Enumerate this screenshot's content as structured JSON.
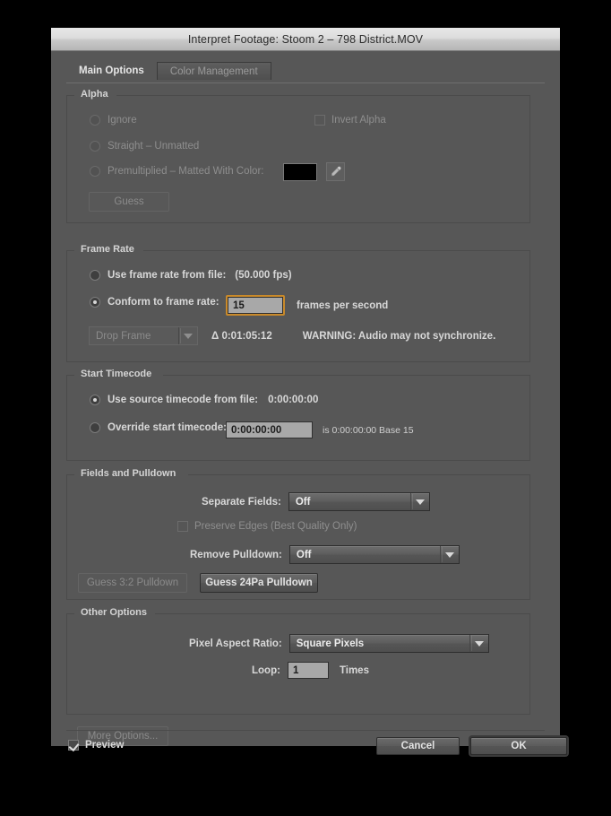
{
  "window": {
    "title": "Interpret Footage: Stoom 2 – 798 District.MOV"
  },
  "tabs": [
    {
      "label": "Main Options",
      "active": true
    },
    {
      "label": "Color Management",
      "active": false
    }
  ],
  "alpha": {
    "legend": "Alpha",
    "ignore_label": "Ignore",
    "straight_label": "Straight – Unmatted",
    "premultiplied_label": "Premultiplied – Matted With Color:",
    "invert_alpha_label": "Invert Alpha",
    "guess_label": "Guess",
    "matte_color": "#000000",
    "eyedropper_icon": "eyedropper-icon",
    "enabled": false
  },
  "frame_rate": {
    "legend": "Frame Rate",
    "use_from_file_label": "Use frame rate from file:",
    "file_fps": "(50.000 fps)",
    "conform_label": "Conform to frame rate:",
    "conform_value": "15",
    "fps_suffix": "frames per second",
    "drop_frame_value": "Drop Frame",
    "delta_label": "Δ 0:01:05:12",
    "warning": "WARNING: Audio may not synchronize."
  },
  "start_timecode": {
    "legend": "Start Timecode",
    "use_source_label": "Use source timecode from file:",
    "source_value": "0:00:00:00",
    "override_label": "Override start timecode:",
    "override_value": "0:00:00:00",
    "override_note": "is 0:00:00:00  Base 15"
  },
  "fields_pulldown": {
    "legend": "Fields and Pulldown",
    "separate_fields_label": "Separate Fields:",
    "separate_fields_value": "Off",
    "preserve_edges_label": "Preserve Edges (Best Quality Only)",
    "remove_pulldown_label": "Remove Pulldown:",
    "remove_pulldown_value": "Off",
    "guess_32_label": "Guess 3:2 Pulldown",
    "guess_24pa_label": "Guess 24Pa Pulldown"
  },
  "other_options": {
    "legend": "Other Options",
    "par_label": "Pixel Aspect Ratio:",
    "par_value": "Square Pixels",
    "loop_label": "Loop:",
    "loop_value": "1",
    "times_label": "Times"
  },
  "more_options_label": "More Options...",
  "footer": {
    "preview_label": "Preview",
    "cancel_label": "Cancel",
    "ok_label": "OK"
  },
  "colors": {
    "dialog_bg": "#575757",
    "focus_ring": "#c98a2b",
    "text": "#d8d8d8",
    "disabled_text": "#8e8e8e"
  }
}
